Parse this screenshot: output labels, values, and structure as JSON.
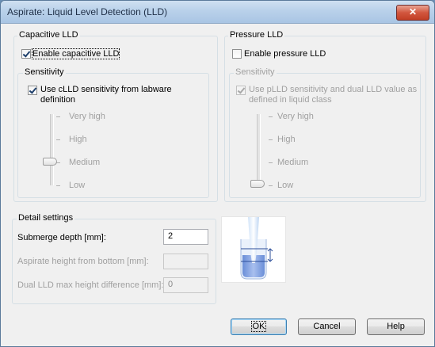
{
  "window": {
    "title": "Aspirate: Liquid Level Detection (LLD)",
    "close_label": "✕"
  },
  "capacitive": {
    "group_label": "Capacitive LLD",
    "enable_label": "Enable capacitive LLD",
    "enable_checked": true,
    "sensitivity": {
      "group_label": "Sensitivity",
      "use_labware_label": "Use cLLD sensitivity from labware definition",
      "use_labware_checked": true,
      "levels": [
        "Very high",
        "High",
        "Medium",
        "Low"
      ],
      "selected": "Medium"
    }
  },
  "pressure": {
    "group_label": "Pressure LLD",
    "enable_label": "Enable pressure LLD",
    "enable_checked": false,
    "sensitivity": {
      "group_label": "Sensitivity",
      "use_liquid_class_label": "Use pLLD sensitivity and dual LLD value as defined in liquid class",
      "use_liquid_class_checked": true,
      "levels": [
        "Very high",
        "High",
        "Medium",
        "Low"
      ],
      "selected": "Low"
    }
  },
  "detail": {
    "group_label": "Detail settings",
    "submerge_label": "Submerge depth [mm]:",
    "submerge_value": "2",
    "aspirate_height_label": "Aspirate height from bottom [mm]:",
    "aspirate_height_value": "",
    "dual_lld_label": "Dual LLD max height difference [mm]:",
    "dual_lld_value": "0"
  },
  "buttons": {
    "ok": "OK",
    "cancel": "Cancel",
    "help": "Help"
  },
  "colors": {
    "titlebar": "#b9d1ea",
    "close": "#c13e25",
    "liquid": "#7f9fdf",
    "accent": "#3c7fb1"
  }
}
